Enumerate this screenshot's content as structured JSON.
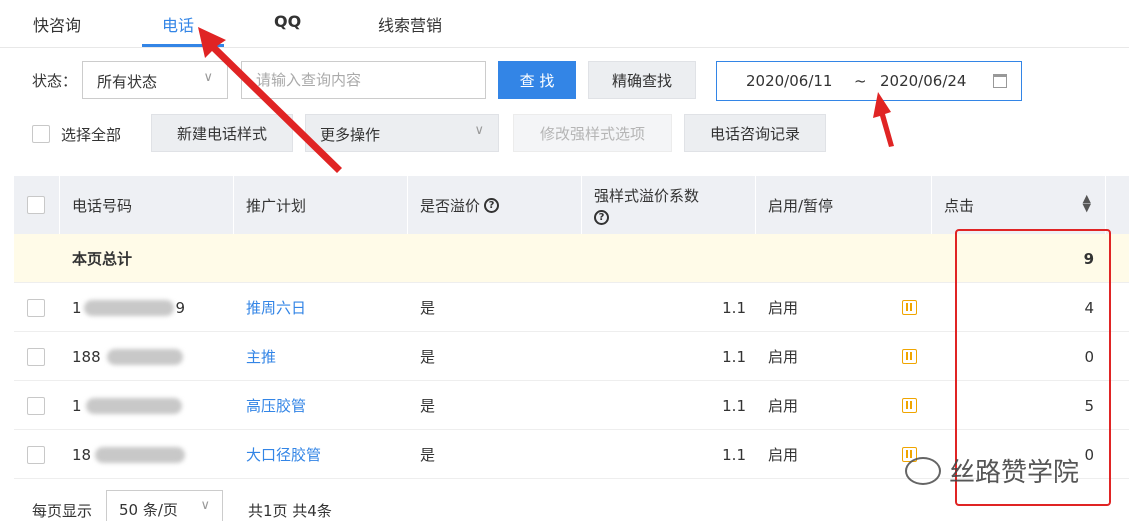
{
  "tabs": [
    {
      "label": "快咨询",
      "active": false
    },
    {
      "label": "电话",
      "active": true
    },
    {
      "label": "QQ",
      "active": false
    },
    {
      "label": "线索营销",
      "active": false
    }
  ],
  "filters": {
    "status_label": "状态：",
    "status_value": "所有状态",
    "search_placeholder": "请输入查询内容",
    "search_button": "查 找",
    "exact_search_button": "精确查找",
    "date_start": "2020/06/11",
    "date_sep": "~",
    "date_end": "2020/06/24"
  },
  "actions": {
    "select_all": "选择全部",
    "new_style": "新建电话样式",
    "more_ops": "更多操作",
    "edit_style_options": "修改强样式选项",
    "call_records": "电话咨询记录"
  },
  "table": {
    "headers": {
      "phone": "电话号码",
      "plan": "推广计划",
      "premium": "是否溢价",
      "coef": "强样式溢价系数",
      "status": "启用/暂停",
      "clicks": "点击"
    },
    "total": {
      "label": "本页总计",
      "clicks": "9"
    },
    "rows": [
      {
        "phone_start": "1",
        "phone_end": "9",
        "plan": "推周六日",
        "premium": "是",
        "coef": "1.1",
        "status": "启用",
        "clicks": "4"
      },
      {
        "phone_start": "188",
        "phone_end": "",
        "plan": "主推",
        "premium": "是",
        "coef": "1.1",
        "status": "启用",
        "clicks": "0"
      },
      {
        "phone_start": "1",
        "phone_end": "",
        "plan": "高压胶管",
        "premium": "是",
        "coef": "1.1",
        "status": "启用",
        "clicks": "5"
      },
      {
        "phone_start": "18",
        "phone_end": "",
        "plan": "大口径胶管",
        "premium": "是",
        "coef": "1.1",
        "status": "启用",
        "clicks": "0"
      }
    ]
  },
  "footer": {
    "per_page_label": "每页显示",
    "per_page_value": "50 条/页",
    "summary": "共1页 共4条"
  },
  "watermark": "丝路赞学院",
  "colors": {
    "accent": "#3385e6",
    "annotation": "#e02424",
    "pause": "#f0a500"
  }
}
